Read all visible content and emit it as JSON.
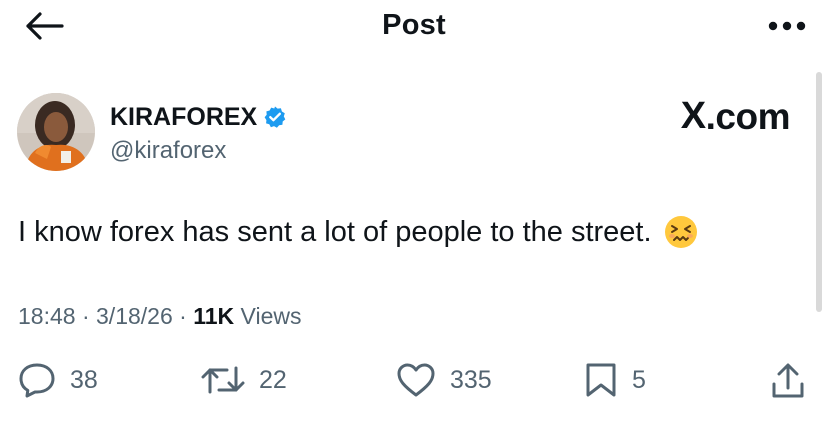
{
  "header": {
    "title": "Post",
    "back_icon": "arrow-left-icon",
    "more_icon": "more-horizontal-icon"
  },
  "author": {
    "display_name": "KIRAFOREX",
    "handle": "@kiraforex",
    "verified_icon": "verified-badge-icon",
    "verified_color": "#1d9bf0"
  },
  "brand": {
    "label_x": "X",
    "label_rest": ".com"
  },
  "post": {
    "text": "I know forex has sent a lot of people to the street.",
    "emoji": "confounded-face-icon"
  },
  "meta": {
    "time": "18:48",
    "separator": " · ",
    "date": "3/18/26",
    "views_count": "11K",
    "views_label": "Views"
  },
  "actions": {
    "replies": "38",
    "reposts": "22",
    "likes": "335",
    "bookmarks": "5"
  },
  "colors": {
    "text": "#0f1419",
    "muted": "#536471",
    "accent": "#1d9bf0"
  }
}
